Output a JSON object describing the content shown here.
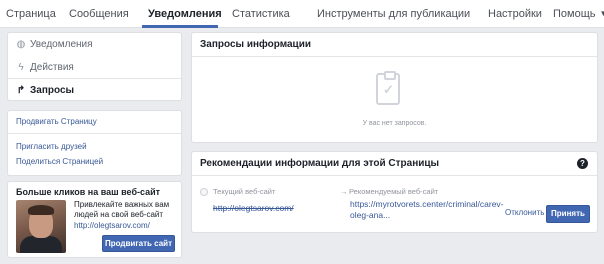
{
  "topnav": {
    "tabs": [
      {
        "label": "Страница"
      },
      {
        "label": "Сообщения"
      },
      {
        "label": "Уведомления",
        "active": true
      },
      {
        "label": "Статистика"
      },
      {
        "label": "Инструменты для публикации"
      }
    ],
    "settings": "Настройки",
    "help": "Помощь"
  },
  "sidebar": {
    "items": [
      {
        "label": "Уведомления",
        "icon": "globe-icon"
      },
      {
        "label": "Действия",
        "icon": "bolt-icon"
      },
      {
        "label": "Запросы",
        "icon": "share-arrow-icon",
        "active": true
      }
    ]
  },
  "links": {
    "promote_page": "Продвигать Страницу",
    "invite_friends": "Пригласить друзей",
    "share_page": "Поделиться Страницей"
  },
  "ad": {
    "title": "Больше кликов на ваш веб-сайт",
    "description": "Привлекайте важных вам людей на свой веб-сайт",
    "url": "http://olegtsarov.com/",
    "button": "Продвигать сайт"
  },
  "requests": {
    "title": "Запросы информации",
    "empty_text": "У вас нет запросов."
  },
  "recommendations": {
    "title": "Рекомендации информации для этой Страницы",
    "help_symbol": "?",
    "current_label": "Текущий веб-сайт",
    "current_url": "http://olegtsarov.com/",
    "arrow": "→",
    "recommended_label": "Рекомендуемый веб-сайт",
    "recommended_url": "https://myrotvorets.center/criminal/carev-oleg-ana...",
    "reject": "Отклонить",
    "accept": "Принять"
  },
  "colors": {
    "accent": "#4267b2",
    "link": "#385898",
    "background": "#e9ebee"
  }
}
